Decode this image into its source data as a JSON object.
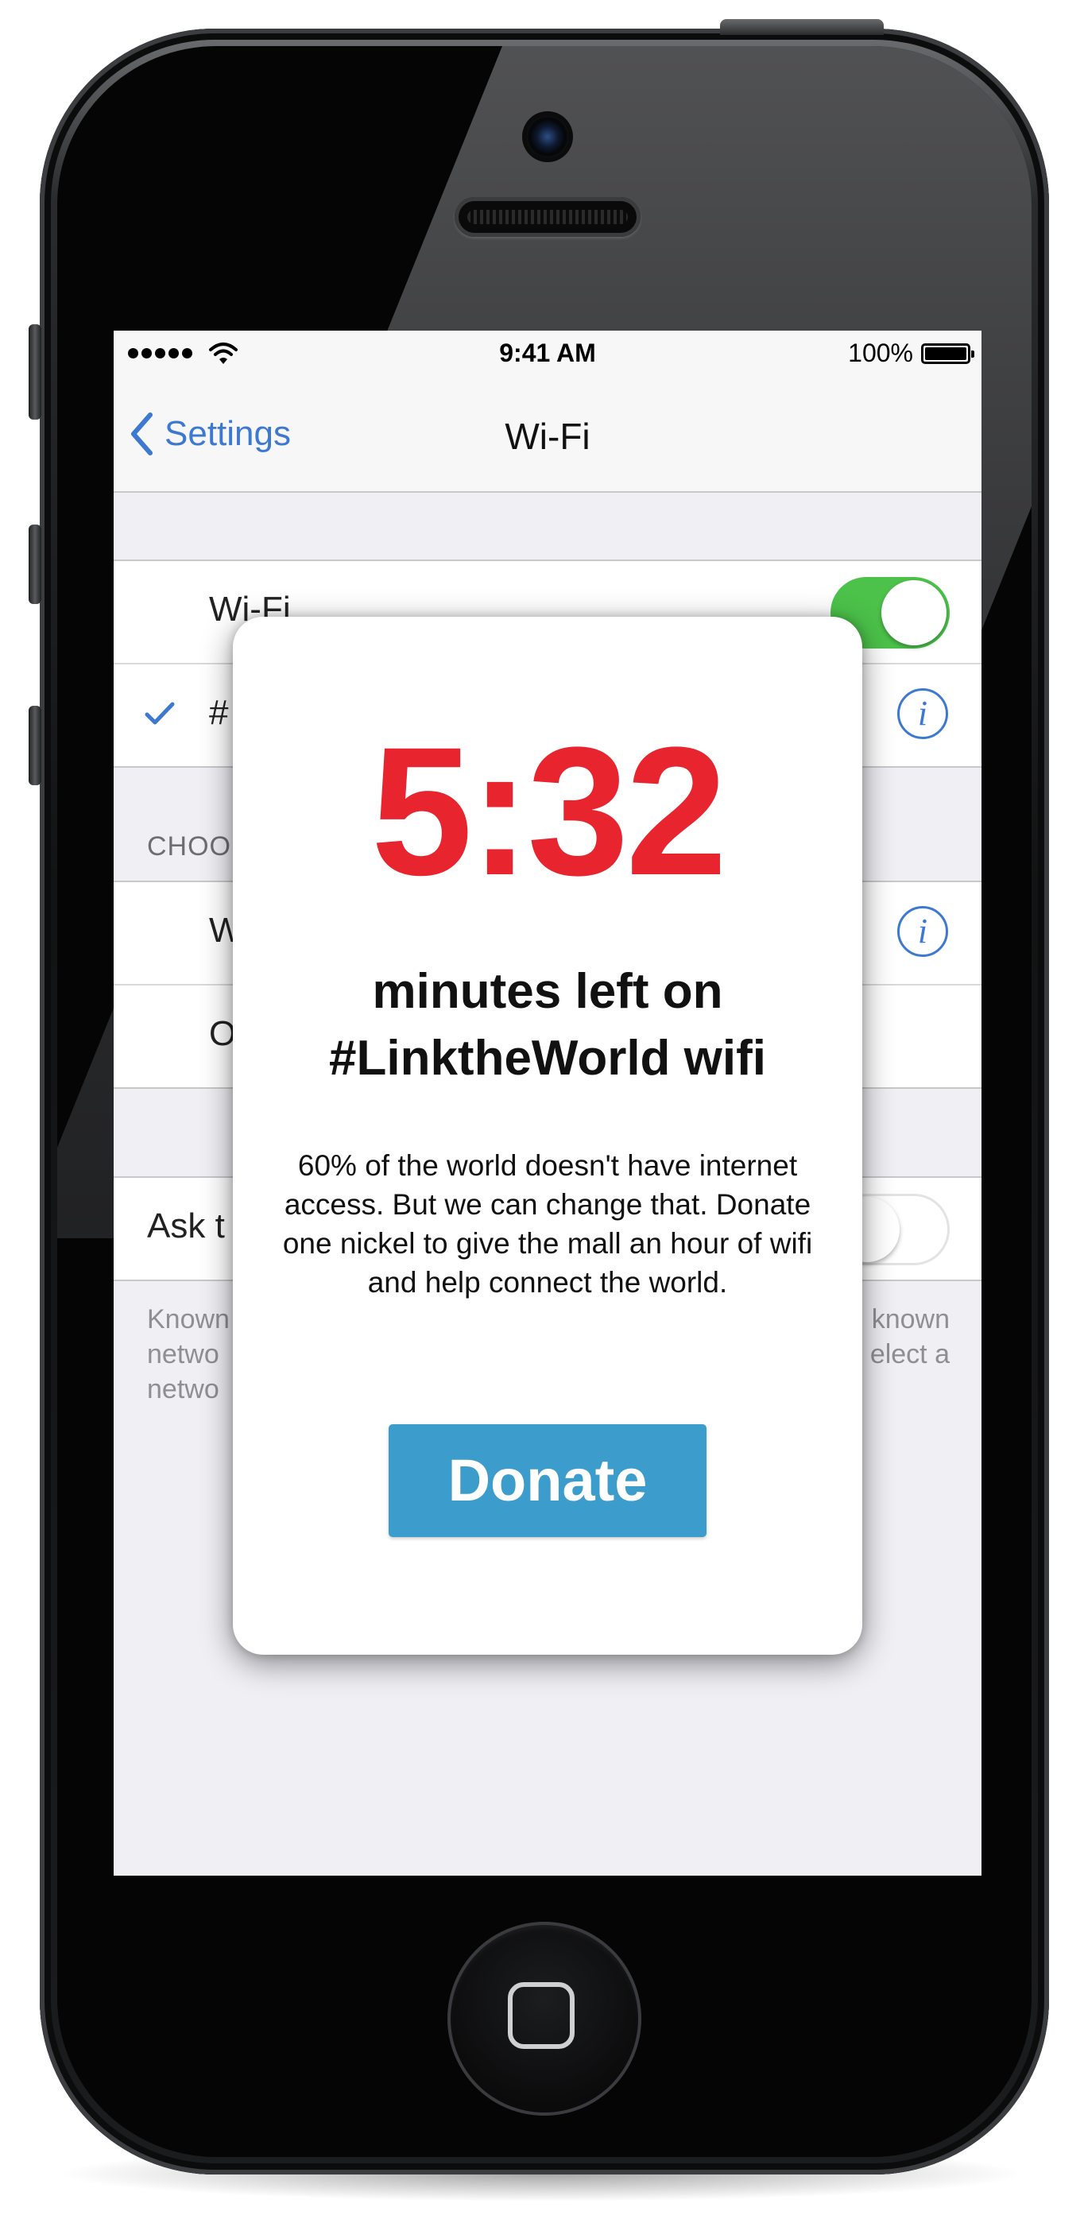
{
  "status_bar": {
    "time": "9:41 AM",
    "battery_percent": "100%",
    "signal_bars": 5
  },
  "nav": {
    "back_label": "Settings",
    "title": "Wi-Fi"
  },
  "wifi_group": {
    "wifi_label": "Wi-Fi",
    "wifi_enabled": true,
    "connected_network_partial": "#"
  },
  "choose_section": {
    "header_partial": "CHOO",
    "networks_partial": [
      "W",
      "O"
    ]
  },
  "ask_section": {
    "label_partial": "Ask t",
    "enabled": false,
    "footer_left": [
      "Known",
      "netwo",
      "netwo"
    ],
    "footer_right": [
      "known",
      "elect a"
    ]
  },
  "modal": {
    "timer": "5:32",
    "headline": "minutes left on #LinktheWorld wifi",
    "body": "60% of the world doesn't have internet access. But we can change that. Donate one nickel to give the mall an hour of wifi and help connect the world.",
    "button_label": "Donate"
  },
  "colors": {
    "ios_blue": "#3d78d1",
    "toggle_green": "#4cc24a",
    "timer_red": "#e8252e",
    "donate_blue": "#3c9ccb"
  },
  "icons": [
    "back-chevron-icon",
    "wifi-icon",
    "battery-icon",
    "checkmark-icon",
    "info-icon",
    "home-button-icon"
  ]
}
